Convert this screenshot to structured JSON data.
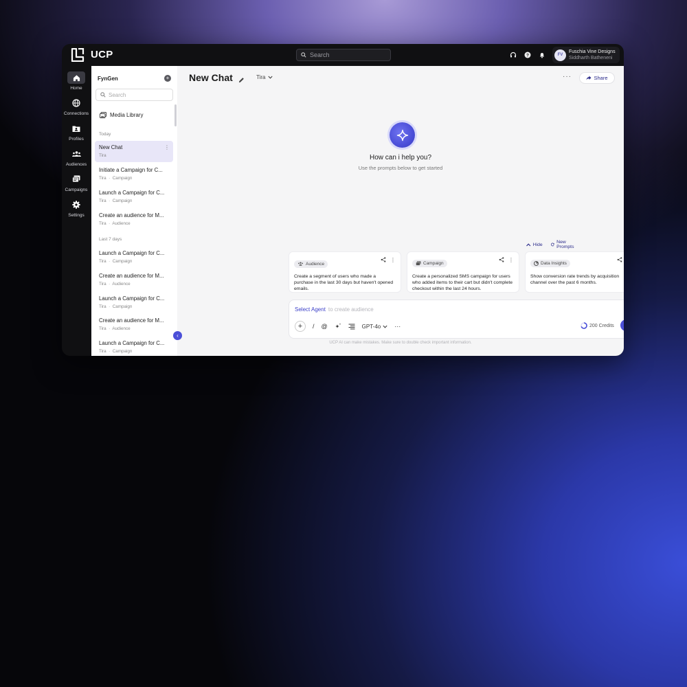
{
  "app": {
    "brand": "UCP",
    "search_placeholder": "Search",
    "user": {
      "initials": "FV",
      "org": "Fuschia Vine Designs",
      "name": "Siddharth Batheneni"
    }
  },
  "rail": {
    "items": [
      {
        "label": "Home",
        "icon": "home-icon"
      },
      {
        "label": "Connections",
        "icon": "globe-icon"
      },
      {
        "label": "Profiles",
        "icon": "profile-folder-icon"
      },
      {
        "label": "Audiences",
        "icon": "users-icon"
      },
      {
        "label": "Campaigns",
        "icon": "campaign-icon"
      },
      {
        "label": "Settings",
        "icon": "gear-icon"
      }
    ]
  },
  "panel": {
    "title": "FynGen",
    "search_placeholder": "Search",
    "media_library": "Media Library",
    "groups": {
      "today": "Today",
      "last7": "Last 7 days"
    },
    "chats": [
      {
        "title": "New Chat",
        "agent": "Tira",
        "type": ""
      },
      {
        "title": "Initiate a Campaign for C...",
        "agent": "Tira",
        "type": "Campaign"
      },
      {
        "title": "Launch a Campaign for C...",
        "agent": "Tira",
        "type": "Campaign"
      },
      {
        "title": "Create an audience for M...",
        "agent": "Tira",
        "type": "Audience"
      },
      {
        "title": "Launch a Campaign for C...",
        "agent": "Tira",
        "type": "Campaign"
      },
      {
        "title": "Create an audience for M...",
        "agent": "Tira",
        "type": "Audience"
      },
      {
        "title": "Launch a Campaign for C...",
        "agent": "Tira",
        "type": "Campaign"
      },
      {
        "title": "Create an audience for M...",
        "agent": "Tira",
        "type": "Audience"
      },
      {
        "title": "Launch a Campaign for C...",
        "agent": "Tira",
        "type": "Campaign"
      }
    ]
  },
  "main": {
    "title": "New Chat",
    "agent": "Tira",
    "share": "Share",
    "hero_title": "How can i help you?",
    "hero_sub": "Use the prompts below to get started",
    "hide": "Hide",
    "new_prompts": "New Prompts",
    "cards": [
      {
        "tag": "Audience",
        "text": "Create a segment of users who made a purchase in the last 30 days but haven't opened emails."
      },
      {
        "tag": "Campaign",
        "text": "Create a personalized SMS campaign for users who added items to their cart but didn't complete checkout within the last 24 hours."
      },
      {
        "tag": "Data Insights",
        "text": "Show conversion rate trends by acquisition channel over the past 6 months."
      }
    ],
    "composer": {
      "select_agent": "Select Agent",
      "placeholder": "to create audience",
      "model": "GPT-4o",
      "credits": "200 Credits"
    },
    "disclaimer": "UCP AI can make mistakes. Make sure to double check important information."
  },
  "colors": {
    "accent": "#4b4fd8",
    "dark": "#101012"
  }
}
